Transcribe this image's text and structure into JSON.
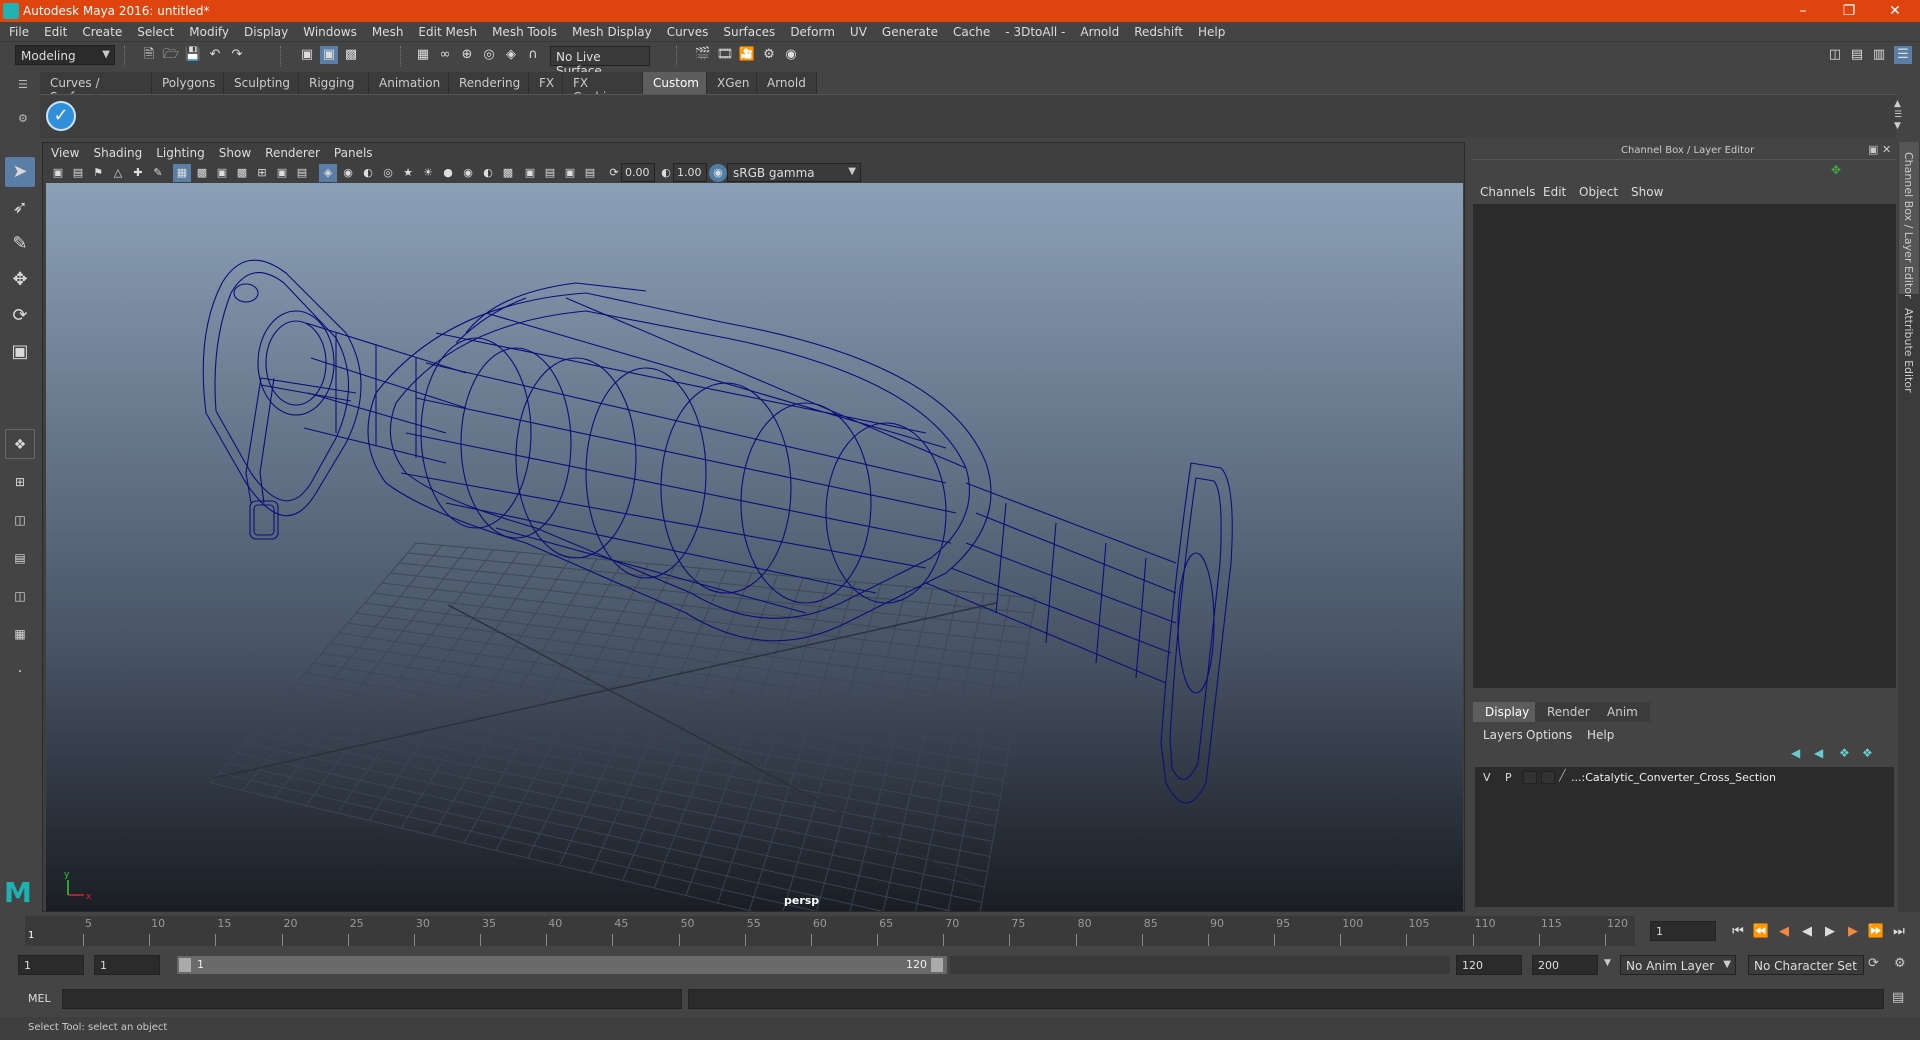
{
  "window": {
    "title": "Autodesk Maya 2016: untitled*"
  },
  "menubar": [
    "File",
    "Edit",
    "Create",
    "Select",
    "Modify",
    "Display",
    "Windows",
    "Mesh",
    "Edit Mesh",
    "Mesh Tools",
    "Mesh Display",
    "Curves",
    "Surfaces",
    "Deform",
    "UV",
    "Generate",
    "Cache",
    "- 3DtoAll -",
    "Arnold",
    "Redshift",
    "Help"
  ],
  "statusline": {
    "mode": "Modeling",
    "live_surface": "No Live Surface"
  },
  "shelf_tabs": [
    "Curves / Surfaces",
    "Polygons",
    "Sculpting",
    "Rigging",
    "Animation",
    "Rendering",
    "FX",
    "FX Caching",
    "Custom",
    "XGen",
    "Arnold"
  ],
  "shelf_active": "Custom",
  "viewport": {
    "menus": [
      "View",
      "Shading",
      "Lighting",
      "Show",
      "Renderer",
      "Panels"
    ],
    "exposure": "0.00",
    "gamma": "1.00",
    "color_space": "sRGB gamma",
    "camera_label": "persp"
  },
  "channel_box": {
    "title": "Channel Box / Layer Editor",
    "menus": [
      "Channels",
      "Edit",
      "Object",
      "Show"
    ],
    "layer_tabs": [
      "Display",
      "Render",
      "Anim"
    ],
    "layer_menus": [
      "Layers",
      "Options",
      "Help"
    ],
    "layer": {
      "v": "V",
      "p": "P",
      "name": "...:Catalytic_Converter_Cross_Section"
    }
  },
  "right_strip": {
    "tab1": "Channel Box / Layer Editor",
    "tab2": "Attribute Editor"
  },
  "timeslider": {
    "ticks": [
      5,
      10,
      15,
      20,
      25,
      30,
      35,
      40,
      45,
      50,
      55,
      60,
      65,
      70,
      75,
      80,
      85,
      90,
      95,
      100,
      105,
      110,
      115,
      120
    ],
    "start_marker": "1",
    "current_frame": "1"
  },
  "range": {
    "start": "1",
    "start2": "1",
    "slider_start": "1",
    "slider_end": "120",
    "end": "120",
    "end2": "200",
    "anim_layer": "No Anim Layer",
    "character_set": "No Character Set"
  },
  "command": {
    "label": "MEL"
  },
  "help": {
    "text": "Select Tool: select an object"
  },
  "colors": {
    "titlebar": "#e0440e",
    "wireframe": "#0d0d7a",
    "active_tool": "#5a7ea6"
  }
}
